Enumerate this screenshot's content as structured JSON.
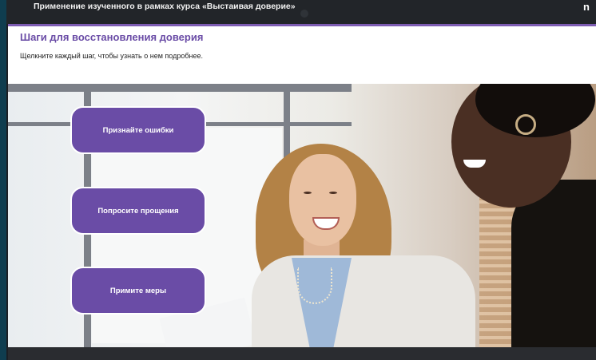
{
  "course": {
    "title": "Применение изученного в рамках курса «Выстаивая доверие»",
    "menu_label": "n"
  },
  "slide": {
    "title": "Шаги для восстановления доверия",
    "instruction": "Щелкните каждый шаг, чтобы узнать о нем подробнее."
  },
  "steps": [
    {
      "label": "Признайте ошибки"
    },
    {
      "label": "Попросите прощения"
    },
    {
      "label": "Примите меры"
    }
  ],
  "colors": {
    "accent": "#6a4ca6",
    "background": "#0f3d4f",
    "bezel": "#1c1f24"
  }
}
